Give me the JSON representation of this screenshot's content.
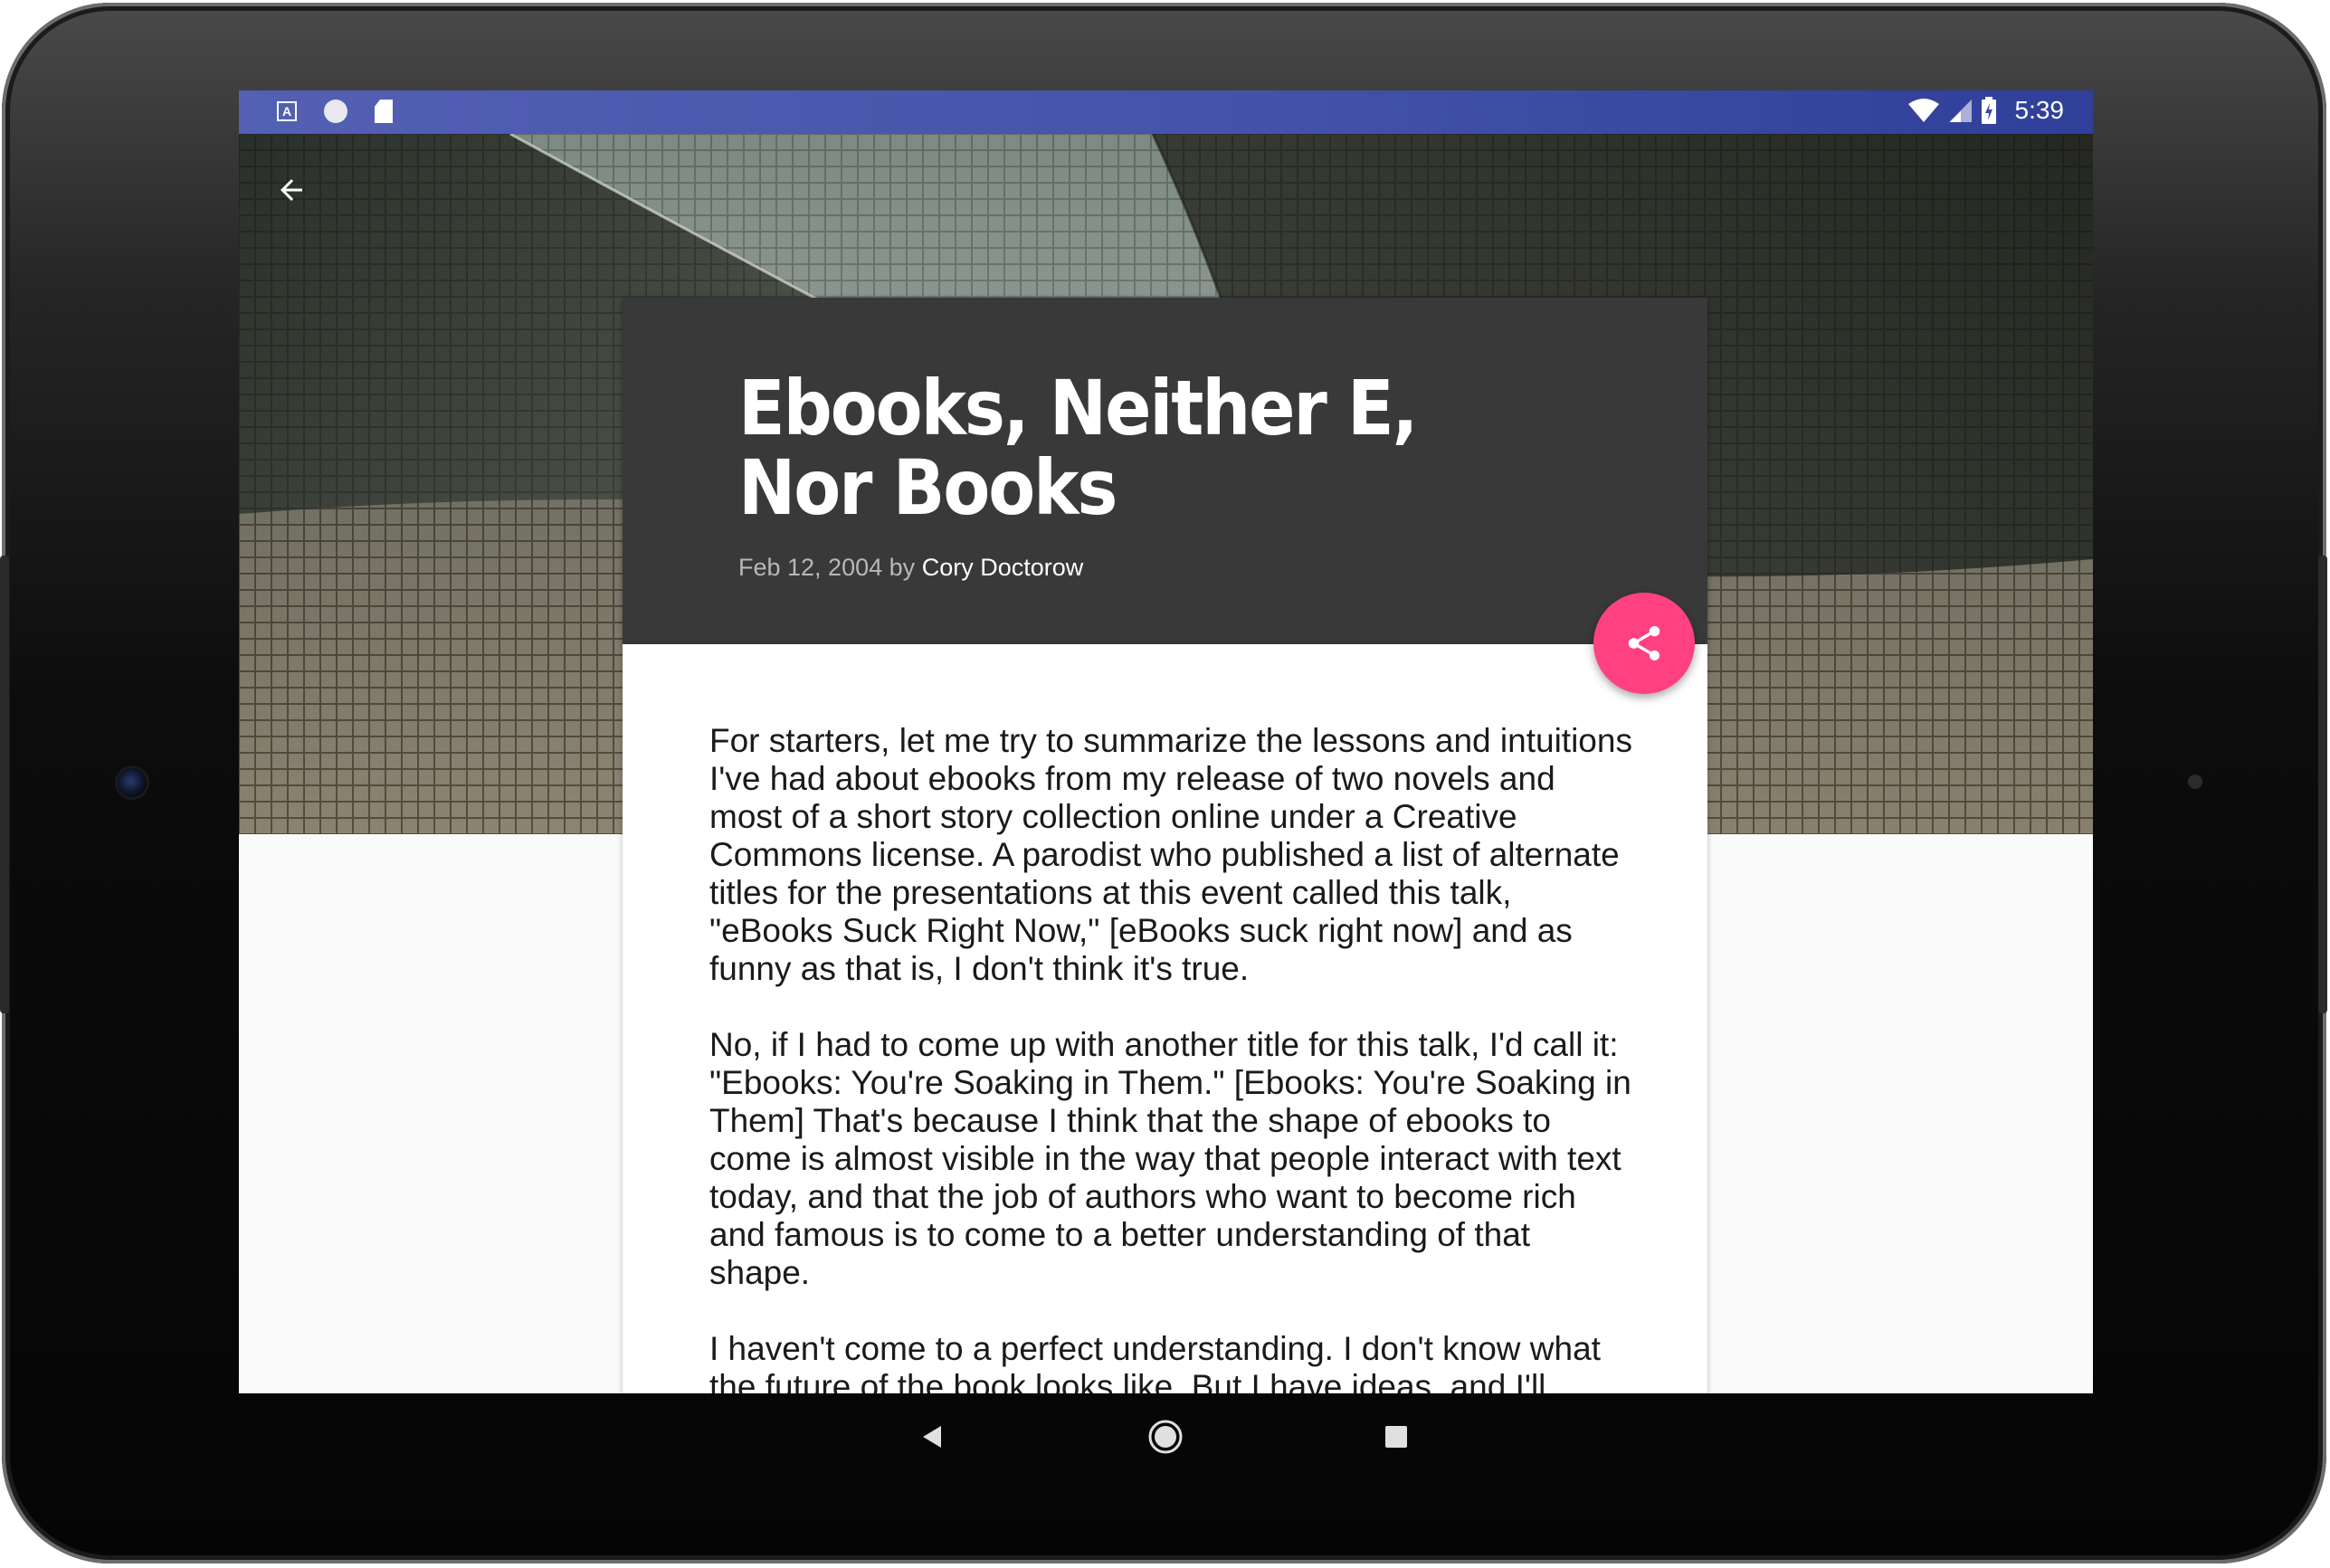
{
  "status_bar": {
    "time": "5:39",
    "left_icons": [
      "a-notification-icon",
      "circle-notification-icon",
      "sd-card-icon"
    ],
    "right_icons": [
      "wifi-icon",
      "cell-signal-icon",
      "battery-charging-icon"
    ]
  },
  "toolbar": {
    "back_icon": "arrow-back-icon"
  },
  "article": {
    "title": "Ebooks, Neither E, Nor Books",
    "date": "Feb 12, 2004",
    "by": "by",
    "author": "Cory Doctorow",
    "paragraphs": [
      "For starters, let me try to summarize the lessons and intuitions I've had about ebooks from my release of two novels and most of a short story collection online under a Creative Commons license. A parodist who published a list of alternate titles for the presentations at this event called this talk, \"eBooks Suck Right Now,\" [eBooks suck right now] and as funny as that is, I don't think it's true.",
      "No, if I had to come up with another title for this talk, I'd call it: \"Ebooks: You're Soaking in Them.\" [Ebooks: You're Soaking in Them] That's because I think that the shape of ebooks to come is almost visible in the way that people interact with text today, and that the job of authors who want to become rich and famous is to come to a better understanding of that shape.",
      "I haven't come to a perfect understanding. I don't know what the future of the book looks like. But I have ideas, and I'll share"
    ]
  },
  "share_button": {
    "icon": "share-icon",
    "color": "#ff4081"
  },
  "nav_bar": {
    "buttons": [
      "back-triangle-icon",
      "home-circle-icon",
      "recents-square-icon"
    ]
  },
  "colors": {
    "status_bar": "#4453a8",
    "card_header": "#393939",
    "accent": "#ff4081"
  }
}
